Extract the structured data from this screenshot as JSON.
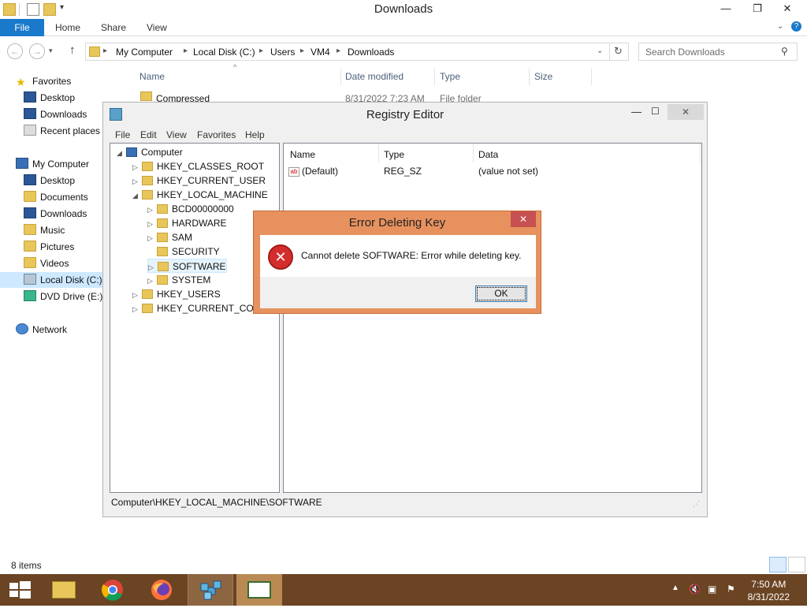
{
  "explorer": {
    "title": "Downloads",
    "window_buttons": {
      "minimize": "—",
      "maximize": "❐",
      "close": "✕"
    },
    "ribbon_tabs": [
      "File",
      "Home",
      "Share",
      "View"
    ],
    "breadcrumbs": [
      "My Computer",
      "Local Disk (C:)",
      "Users",
      "VM4",
      "Downloads"
    ],
    "search_placeholder": "Search Downloads",
    "nav": {
      "favorites": "Favorites",
      "favorites_items": [
        "Desktop",
        "Downloads",
        "Recent places"
      ],
      "computer": "My Computer",
      "computer_items": [
        "Desktop",
        "Documents",
        "Downloads",
        "Music",
        "Pictures",
        "Videos",
        "Local Disk (C:)",
        "DVD Drive (E:) E"
      ],
      "network": "Network"
    },
    "columns": [
      "Name",
      "Date modified",
      "Type",
      "Size"
    ],
    "rows": [
      {
        "name": "Compressed",
        "date": "8/31/2022 7:23 AM",
        "type": "File folder",
        "size": ""
      }
    ],
    "status": "8 items"
  },
  "regedit": {
    "title": "Registry Editor",
    "menu": [
      "File",
      "Edit",
      "View",
      "Favorites",
      "Help"
    ],
    "tree": {
      "root": "Computer",
      "items": [
        "HKEY_CLASSES_ROOT",
        "HKEY_CURRENT_USER",
        "HKEY_LOCAL_MACHINE",
        "BCD00000000",
        "HARDWARE",
        "SAM",
        "SECURITY",
        "SOFTWARE",
        "SYSTEM",
        "HKEY_USERS",
        "HKEY_CURRENT_CONI"
      ]
    },
    "value_columns": [
      "Name",
      "Type",
      "Data"
    ],
    "values": [
      {
        "name": "(Default)",
        "type": "REG_SZ",
        "data": "(value not set)"
      }
    ],
    "status_path": "Computer\\HKEY_LOCAL_MACHINE\\SOFTWARE"
  },
  "dialog": {
    "title": "Error Deleting Key",
    "message": "Cannot delete SOFTWARE:  Error while deleting key.",
    "ok_label": "OK",
    "close_glyph": "✕",
    "accent": "#e7925e"
  },
  "taskbar": {
    "time": "7:50 AM",
    "date": "8/31/2022",
    "color": "#6b4423"
  }
}
